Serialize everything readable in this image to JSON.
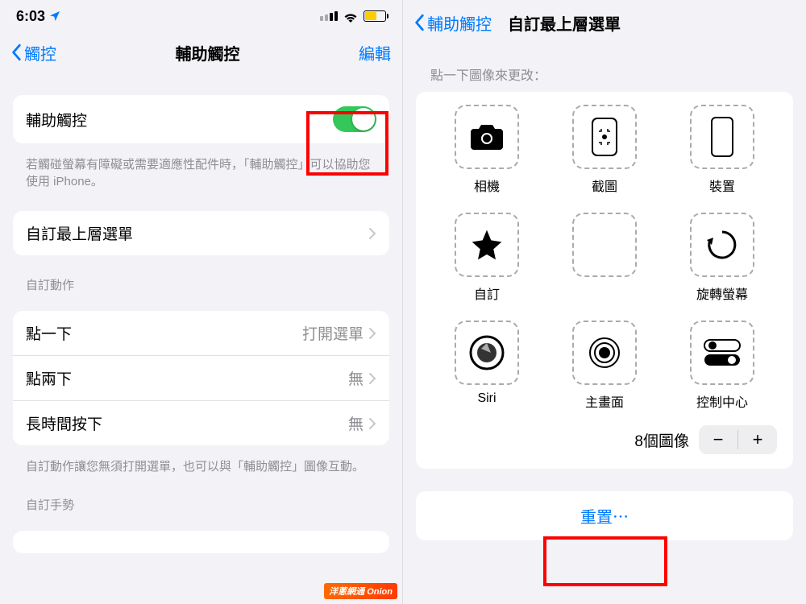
{
  "left": {
    "status_time": "6:03",
    "nav_back": "觸控",
    "nav_title": "輔助觸控",
    "nav_action": "編輯",
    "toggle_label": "輔助觸控",
    "toggle_footer": "若觸碰螢幕有障礙或需要適應性配件時，「輔助觸控」可以協助您使用 iPhone。",
    "customize_label": "自訂最上層選單",
    "actions_header": "自訂動作",
    "actions": [
      {
        "label": "點一下",
        "value": "打開選單"
      },
      {
        "label": "點兩下",
        "value": "無"
      },
      {
        "label": "長時間按下",
        "value": "無"
      }
    ],
    "actions_footer": "自訂動作讓您無須打開選單，也可以與「輔助觸控」圖像互動。",
    "gestures_header": "自訂手勢"
  },
  "right": {
    "nav_back": "輔助觸控",
    "nav_title": "自訂最上層選單",
    "instruction": "點一下圖像來更改：",
    "icons": [
      {
        "name": "camera",
        "label": "相機"
      },
      {
        "name": "screenshot",
        "label": "截圖"
      },
      {
        "name": "device",
        "label": "裝置"
      },
      {
        "name": "custom",
        "label": "自訂"
      },
      {
        "name": "empty",
        "label": ""
      },
      {
        "name": "rotate",
        "label": "旋轉螢幕"
      },
      {
        "name": "siri",
        "label": "Siri"
      },
      {
        "name": "home",
        "label": "主畫面"
      },
      {
        "name": "control-center",
        "label": "控制中心"
      }
    ],
    "count_label": "8個圖像",
    "reset_label": "重置⋯"
  }
}
